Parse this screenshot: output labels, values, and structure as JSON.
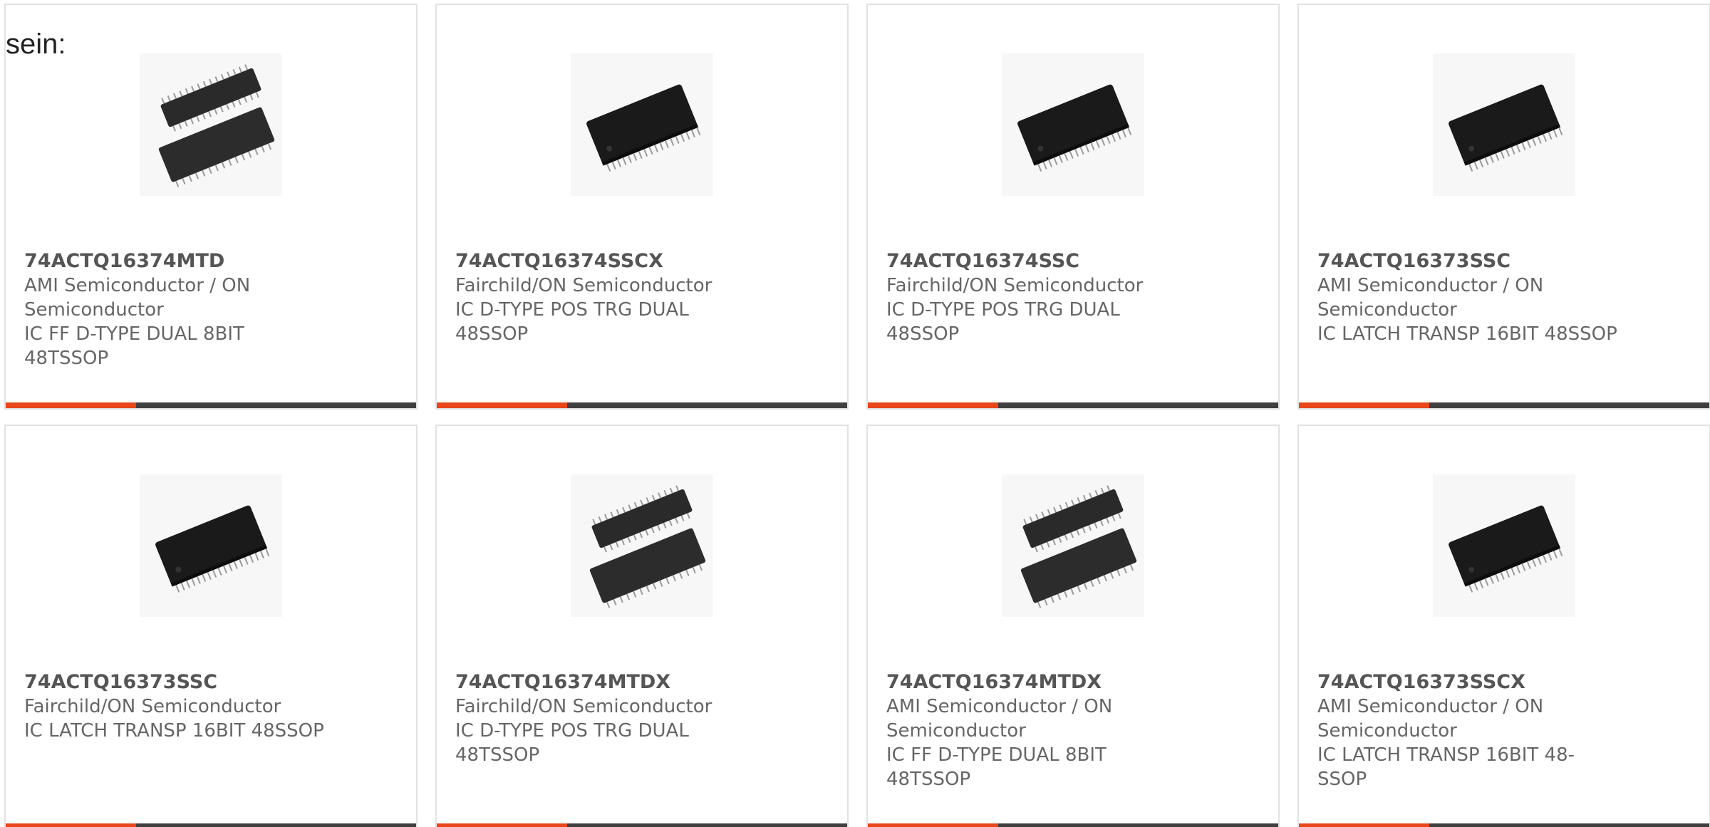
{
  "intro_text": "sein:",
  "colors": {
    "accent": "#e8461b",
    "bar_dark": "#3f3f3f",
    "border": "#e2e2e2",
    "text": "#666666",
    "part_text": "#555555"
  },
  "products": [
    {
      "part": "74ACTQ16374MTD",
      "manufacturer": "AMI Semiconductor / ON Semiconductor",
      "description": "IC FF D-TYPE DUAL 8BIT 48TSSOP",
      "image_icon": "tssop-dual-chip-icon"
    },
    {
      "part": "74ACTQ16374SSCX",
      "manufacturer": "Fairchild/ON Semiconductor",
      "description": "IC D-TYPE POS TRG DUAL 48SSOP",
      "image_icon": "ssop-chip-icon"
    },
    {
      "part": "74ACTQ16374SSC",
      "manufacturer": "Fairchild/ON Semiconductor",
      "description": "IC D-TYPE POS TRG DUAL 48SSOP",
      "image_icon": "ssop-chip-icon"
    },
    {
      "part": "74ACTQ16373SSC",
      "manufacturer": "AMI Semiconductor / ON Semiconductor",
      "description": "IC LATCH TRANSP 16BIT 48SSOP",
      "image_icon": "ssop-chip-icon"
    },
    {
      "part": "74ACTQ16373SSC",
      "manufacturer": "Fairchild/ON Semiconductor",
      "description": "IC LATCH TRANSP 16BIT 48SSOP",
      "image_icon": "ssop-chip-icon"
    },
    {
      "part": "74ACTQ16374MTDX",
      "manufacturer": "Fairchild/ON Semiconductor",
      "description": "IC D-TYPE POS TRG DUAL 48TSSOP",
      "image_icon": "tssop-dual-chip-icon"
    },
    {
      "part": "74ACTQ16374MTDX",
      "manufacturer": "AMI Semiconductor / ON Semiconductor",
      "description": "IC FF D-TYPE DUAL 8BIT 48TSSOP",
      "image_icon": "tssop-dual-chip-icon"
    },
    {
      "part": "74ACTQ16373SSCX",
      "manufacturer": "AMI Semiconductor / ON Semiconductor",
      "description": "IC LATCH TRANSP 16BIT 48-SSOP",
      "image_icon": "ssop-chip-icon"
    }
  ]
}
